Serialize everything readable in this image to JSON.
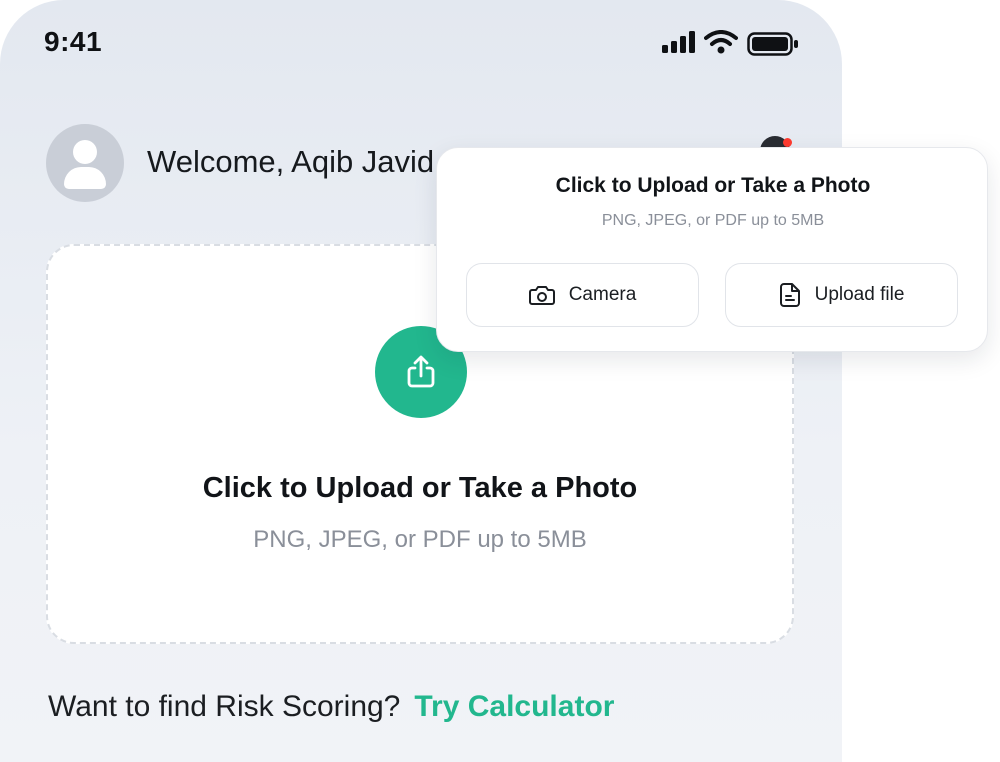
{
  "status_bar": {
    "time": "9:41",
    "icons": [
      "signal-icon",
      "wifi-icon",
      "battery-icon"
    ]
  },
  "header": {
    "welcome_text": "Welcome, Aqib Javid",
    "avatar_icon": "user-avatar-icon",
    "notification_icon": "bell-icon",
    "notification_dot_color": "#ff3b30"
  },
  "upload_area": {
    "icon": "share-upload-icon",
    "title": "Click to Upload or Take a Photo",
    "subtitle": "PNG, JPEG, or PDF up to 5MB",
    "accent_color": "#22b78e"
  },
  "footer_prompt": {
    "text": "Want to find Risk Scoring?",
    "link_text": "Try Calculator"
  },
  "upload_popup": {
    "title": "Click to Upload or Take a Photo",
    "subtitle": "PNG, JPEG, or PDF up to 5MB",
    "options": [
      {
        "label": "Camera",
        "icon": "camera-icon"
      },
      {
        "label": "Upload file",
        "icon": "file-icon"
      }
    ]
  }
}
